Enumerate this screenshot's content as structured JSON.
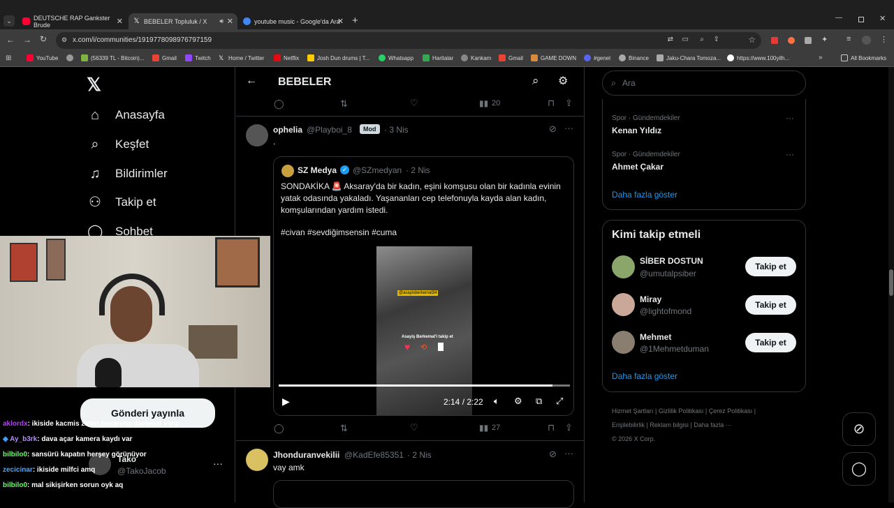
{
  "browser": {
    "tabs": [
      {
        "title": "DEUTSCHE RAP Gankster Brude",
        "close": "✕",
        "color": "#ff0033"
      },
      {
        "title": "BEBELER Topluluk / X",
        "close": "✕",
        "color": "#ffffff"
      },
      {
        "title": "youtube music - Google'da Ara",
        "close": "✕",
        "color": "#4285f4"
      }
    ],
    "new_tab": "+",
    "url": "x.com/i/communities/1919778098976797159",
    "bookmarks": [
      {
        "label": "YouTube",
        "color": "#ff0033"
      },
      {
        "label": "",
        "color": "#999999"
      },
      {
        "label": "(56339 TL - Bitcoin)...",
        "color": "#7cb342"
      },
      {
        "label": "Gmail",
        "color": "#ea4335"
      },
      {
        "label": "Twitch",
        "color": "#9146ff"
      },
      {
        "label": "Home / Twitter",
        "color": "#ffffff"
      },
      {
        "label": "Netflix",
        "color": "#e50914"
      },
      {
        "label": "Josh Dun drums | T...",
        "color": "#ffcc00"
      },
      {
        "label": "Whatsapp",
        "color": "#25d366"
      },
      {
        "label": "Haritalar",
        "color": "#34a853"
      },
      {
        "label": "Kankam",
        "color": "#888888"
      },
      {
        "label": "Gmail",
        "color": "#ea4335"
      },
      {
        "label": "GAME DOWN",
        "color": "#d88a3c"
      },
      {
        "label": "#genel",
        "color": "#5865f2"
      },
      {
        "label": "Binance",
        "color": "#aaaaaa"
      },
      {
        "label": "Jaku-Chara Tomoza...",
        "color": "#aaaaaa"
      },
      {
        "label": "https://www.100yilh...",
        "color": "#ffffff"
      }
    ],
    "all_bookmarks": "All Bookmarks"
  },
  "nav": {
    "items": [
      {
        "label": "Anasayfa",
        "icon": "home-icon"
      },
      {
        "label": "Keşfet",
        "icon": "search-icon"
      },
      {
        "label": "Bildirimler",
        "icon": "bell-icon"
      },
      {
        "label": "Takip et",
        "icon": "follow-icon"
      },
      {
        "label": "Sohbet",
        "icon": "chat-icon"
      }
    ],
    "post_button": "Gönderi yayınla",
    "account": {
      "name": "Tako",
      "handle": "@TakoJacob"
    }
  },
  "header": {
    "title": "BEBELER"
  },
  "feed": {
    "top_actions": {
      "views": "20"
    },
    "post1": {
      "name": "ophelia",
      "handle": "@Playboi_8",
      "badge": "Mod",
      "time": "· 3 Nis",
      "text": ".",
      "quote": {
        "name": "SZ Medya",
        "handle": "@SZmedyan",
        "time": "· 2 Nis",
        "text": "SONDAKİKA 🚨 Aksaray'da bir kadın, eşini komşusu olan bir kadınla evinin yatak odasında yakaladı. Yaşananları cep telefonuyla kayda alan kadın, komşularından yardım istedi.",
        "hashtags": "#civan #sevdiğimsensin #cuma",
        "video_time": "2:14 / 2:22",
        "video_progress": 0.94,
        "overlay_tag": "@asayisberkemal34",
        "overlay_caption": "Asayiş Berkemal'i takip et"
      },
      "views": "27"
    },
    "post2": {
      "name": "Jhonduranvekilii",
      "handle": "@KadEfe85351",
      "time": "· 2 Nis",
      "text": "vay amk"
    }
  },
  "right": {
    "search_placeholder": "Ara",
    "trends": [
      {
        "category": "Spor · Gündemdekiler",
        "name": "Kenan Yıldız"
      },
      {
        "category": "Spor · Gündemdekiler",
        "name": "Ahmet Çakar"
      }
    ],
    "show_more": "Daha fazla göster",
    "who_to_follow_title": "Kimi takip etmeli",
    "follow": [
      {
        "name": "SİBER DOSTUN",
        "handle": "@umutalpsiber",
        "button": "Takip et"
      },
      {
        "name": "Miray",
        "handle": "@lightofmond",
        "button": "Takip et"
      },
      {
        "name": "Mehmet",
        "handle": "@1Mehmetduman",
        "button": "Takip et"
      }
    ],
    "show_more2": "Daha fazla göster",
    "footer": [
      "Hizmet Şartları",
      "Gizlilik Politikası",
      "Çerez Politikası",
      "Erişilebilirlik",
      "Reklam bilgisi",
      "Daha fazla ···"
    ],
    "copyright": "© 2026 X Corp."
  },
  "chat": [
    {
      "user": "aklordx",
      "color": "#b33dff",
      "msg": ": ikiside kacmis zaten bosanma davasini yiyip"
    },
    {
      "user": "Ay_b3rk",
      "color": "#b38cff",
      "msg": ": dava açar kamera kaydı var"
    },
    {
      "user": "bilbilo0",
      "color": "#66ff66",
      "msg": ": sansürü kapatın herşey görünüyor"
    },
    {
      "user": "zecicinar",
      "color": "#4da6ff",
      "msg": ": ikiside milfci amq"
    },
    {
      "user": "bilbilo0",
      "color": "#66ff66",
      "msg": ": mal sikişirken sorun oyk aq"
    }
  ]
}
